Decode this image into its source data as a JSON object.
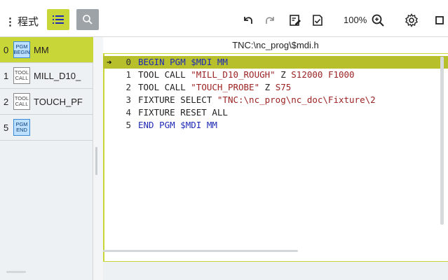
{
  "toolbar": {
    "menu_label": "程式",
    "zoom_level": "100%"
  },
  "programs": [
    {
      "number": "0",
      "badge_line1": "PGM",
      "badge_line2": "BEGIN",
      "label": "MM",
      "active": true,
      "badge_style": "blue"
    },
    {
      "number": "1",
      "badge_line1": "TOOL",
      "badge_line2": "CALL",
      "label": "MILL_D10_",
      "active": false,
      "badge_style": "gray"
    },
    {
      "number": "2",
      "badge_line1": "TOOL",
      "badge_line2": "CALL",
      "label": "TOUCH_PF",
      "active": false,
      "badge_style": "gray"
    },
    {
      "number": "5",
      "badge_line1": "PGM",
      "badge_line2": "END",
      "label": "",
      "active": false,
      "badge_style": "blue"
    }
  ],
  "editor": {
    "file_path": "TNC:\\nc_prog\\$mdi.h",
    "lines": [
      {
        "number": "0",
        "tokens": [
          {
            "t": "BEGIN PGM $MDI MM",
            "c": "kw"
          }
        ]
      },
      {
        "number": "1",
        "tokens": [
          {
            "t": "TOOL CALL ",
            "c": "plain"
          },
          {
            "t": "\"MILL_D10_ROUGH\"",
            "c": "str"
          },
          {
            "t": " Z ",
            "c": "plain"
          },
          {
            "t": "S12000 F1000",
            "c": "str"
          }
        ]
      },
      {
        "number": "2",
        "tokens": [
          {
            "t": "TOOL CALL ",
            "c": "plain"
          },
          {
            "t": "\"TOUCH_PROBE\"",
            "c": "str"
          },
          {
            "t": " Z ",
            "c": "plain"
          },
          {
            "t": "S75",
            "c": "str"
          }
        ]
      },
      {
        "number": "3",
        "tokens": [
          {
            "t": "FIXTURE SELECT ",
            "c": "plain"
          },
          {
            "t": "\"TNC:\\nc_prog\\nc_doc\\Fixture\\2",
            "c": "str"
          }
        ]
      },
      {
        "number": "4",
        "tokens": [
          {
            "t": "FIXTURE RESET ALL",
            "c": "plain"
          }
        ]
      },
      {
        "number": "5",
        "tokens": [
          {
            "t": "END PGM $MDI MM",
            "c": "kw"
          }
        ]
      }
    ],
    "active_line": 0
  }
}
